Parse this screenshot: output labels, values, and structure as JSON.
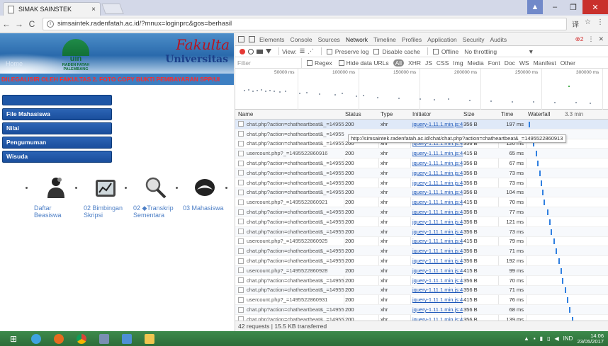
{
  "browser": {
    "tab_title": "SIMAK SAINSTEK",
    "tab_close": "×",
    "url": "simsaintek.radenfatah.ac.id/?mnux=loginprc&gos=berhasil",
    "back": "←",
    "forward": "→",
    "reload": "C",
    "info": "i",
    "window_min": "–",
    "window_max": "❐",
    "window_close": "✕",
    "user_icon": "▲",
    "translate_icon": "译",
    "star_icon": "☆",
    "menu_icon": "⋮"
  },
  "site": {
    "home": "Home",
    "uin": "uin",
    "raden_fatah": "RADEN FATAH\nPALEMBANG",
    "fakultas": "Fakulta",
    "universitas": "Universitas",
    "marquee": "DILEGALISIR OLEH FAKULTAS 2. FOTO COPY BUKTI PEMBAYARAN SPP/UI",
    "menu": [
      "File Mahasiswa",
      "Nilai",
      "Pengumuman",
      "Wisuda"
    ],
    "shortcuts": [
      {
        "label": "Daftar\nBeasiswa",
        "icon": "person-icon"
      },
      {
        "label": "02 Bimbingan\nSkripsi",
        "icon": "chart-icon"
      },
      {
        "label": "02 ◆Transkrip\nSementara",
        "icon": "magnifier-icon"
      },
      {
        "label": "03 Mahasiswa",
        "icon": "helmet-icon"
      }
    ]
  },
  "devtools": {
    "tabs": [
      "Elements",
      "Console",
      "Sources",
      "Network",
      "Timeline",
      "Profiles",
      "Application",
      "Security",
      "Audits"
    ],
    "active_tab": "Network",
    "error_count": "2",
    "controls": {
      "view": "View:",
      "preserve_log": "Preserve log",
      "disable_cache": "Disable cache",
      "offline": "Offline",
      "throttling": "No throttling",
      "dropdown": "▼"
    },
    "filter": {
      "placeholder": "Filter",
      "regex": "Regex",
      "hide_data_urls": "Hide data URLs",
      "all": "All",
      "types": [
        "XHR",
        "JS",
        "CSS",
        "Img",
        "Media",
        "Font",
        "Doc",
        "WS",
        "Manifest",
        "Other"
      ]
    },
    "overview_ticks": [
      "50000 ms",
      "100000 ms",
      "150000 ms",
      "200000 ms",
      "250000 ms",
      "300000 ms"
    ],
    "columns": [
      "Name",
      "Status",
      "Type",
      "Initiator",
      "Size",
      "Time",
      "Waterfall"
    ],
    "waterfall_label": "3.3 min",
    "tooltip": "http://simsaintek.radenfatah.ac.id/chat/chat.php?action=chatheartbeat&_=1495522860913",
    "rows": [
      {
        "name": "chat.php?action=chatheartbeat&_=149552...",
        "status": "200",
        "type": "xhr",
        "initiator": "jquery-1.11.1.min.js:4",
        "size": "356 B",
        "time": "197 ms",
        "wf": 0.01
      },
      {
        "name": "chat.php?action=chatheartbeat&_=149552...",
        "status": "",
        "type": "",
        "initiator": "",
        "size": "",
        "time": "",
        "wf": null
      },
      {
        "name": "chat.php?action=chatheartbeat&_=149552...",
        "status": "200",
        "type": "xhr",
        "initiator": "jquery-1.11.1.min.js:4",
        "size": "356 B",
        "time": "120 ms",
        "wf": 0.06
      },
      {
        "name": "usercount.php?_=1495522860916",
        "status": "200",
        "type": "xhr",
        "initiator": "jquery-1.11.1.min.js:4",
        "size": "415 B",
        "time": "65 ms",
        "wf": 0.1
      },
      {
        "name": "chat.php?action=chatheartbeat&_=149552...",
        "status": "200",
        "type": "xhr",
        "initiator": "jquery-1.11.1.min.js:4",
        "size": "356 B",
        "time": "67 ms",
        "wf": 0.12
      },
      {
        "name": "chat.php?action=chatheartbeat&_=149552...",
        "status": "200",
        "type": "xhr",
        "initiator": "jquery-1.11.1.min.js:4",
        "size": "356 B",
        "time": "73 ms",
        "wf": 0.14
      },
      {
        "name": "chat.php?action=chatheartbeat&_=149552...",
        "status": "200",
        "type": "xhr",
        "initiator": "jquery-1.11.1.min.js:4",
        "size": "356 B",
        "time": "73 ms",
        "wf": 0.16
      },
      {
        "name": "chat.php?action=chatheartbeat&_=149552...",
        "status": "200",
        "type": "xhr",
        "initiator": "jquery-1.11.1.min.js:4",
        "size": "356 B",
        "time": "104 ms",
        "wf": 0.18
      },
      {
        "name": "usercount.php?_=1495522860921",
        "status": "200",
        "type": "xhr",
        "initiator": "jquery-1.11.1.min.js:4",
        "size": "415 B",
        "time": "70 ms",
        "wf": 0.2
      },
      {
        "name": "chat.php?action=chatheartbeat&_=149552...",
        "status": "200",
        "type": "xhr",
        "initiator": "jquery-1.11.1.min.js:4",
        "size": "356 B",
        "time": "77 ms",
        "wf": 0.24
      },
      {
        "name": "chat.php?action=chatheartbeat&_=149552...",
        "status": "200",
        "type": "xhr",
        "initiator": "jquery-1.11.1.min.js:4",
        "size": "356 B",
        "time": "121 ms",
        "wf": 0.27
      },
      {
        "name": "chat.php?action=chatheartbeat&_=149552...",
        "status": "200",
        "type": "xhr",
        "initiator": "jquery-1.11.1.min.js:4",
        "size": "356 B",
        "time": "73 ms",
        "wf": 0.29
      },
      {
        "name": "usercount.php?_=1495522860925",
        "status": "200",
        "type": "xhr",
        "initiator": "jquery-1.11.1.min.js:4",
        "size": "415 B",
        "time": "79 ms",
        "wf": 0.32
      },
      {
        "name": "chat.php?action=chatheartbeat&_=149552...",
        "status": "200",
        "type": "xhr",
        "initiator": "jquery-1.11.1.min.js:4",
        "size": "356 B",
        "time": "71 ms",
        "wf": 0.35
      },
      {
        "name": "chat.php?action=chatheartbeat&_=149552...",
        "status": "200",
        "type": "xhr",
        "initiator": "jquery-1.11.1.min.js:4",
        "size": "356 B",
        "time": "192 ms",
        "wf": 0.38
      },
      {
        "name": "usercount.php?_=1495522860928",
        "status": "200",
        "type": "xhr",
        "initiator": "jquery-1.11.1.min.js:4",
        "size": "415 B",
        "time": "99 ms",
        "wf": 0.41
      },
      {
        "name": "chat.php?action=chatheartbeat&_=149552...",
        "status": "200",
        "type": "xhr",
        "initiator": "jquery-1.11.1.min.js:4",
        "size": "356 B",
        "time": "70 ms",
        "wf": 0.43
      },
      {
        "name": "chat.php?action=chatheartbeat&_=149552...",
        "status": "200",
        "type": "xhr",
        "initiator": "jquery-1.11.1.min.js:4",
        "size": "356 B",
        "time": "71 ms",
        "wf": 0.46
      },
      {
        "name": "usercount.php?_=1495522860931",
        "status": "200",
        "type": "xhr",
        "initiator": "jquery-1.11.1.min.js:4",
        "size": "415 B",
        "time": "76 ms",
        "wf": 0.49
      },
      {
        "name": "chat.php?action=chatheartbeat&_=149552...",
        "status": "200",
        "type": "xhr",
        "initiator": "jquery-1.11.1.min.js:4",
        "size": "356 B",
        "time": "68 ms",
        "wf": 0.52
      },
      {
        "name": "chat.php?action=chatheartbeat&_=149552...",
        "status": "200",
        "type": "xhr",
        "initiator": "jquery-1.11.1.min.js:4",
        "size": "356 B",
        "time": "139 ms",
        "wf": 0.55
      }
    ],
    "status_bar": "42 requests  |  15.5 KB transferred"
  },
  "taskbar": {
    "tray_lang": "IND",
    "clock_time": "14:06",
    "clock_date": "23/05/2017"
  },
  "colors": {
    "menu_blue": "#1e56a6",
    "marquee_red": "#ff2a2a",
    "link_blue": "#1a55b8",
    "waterfall_blue": "#2f7fe0",
    "record_red": "#e53935",
    "taskbar_green": "#3d8a4b"
  }
}
